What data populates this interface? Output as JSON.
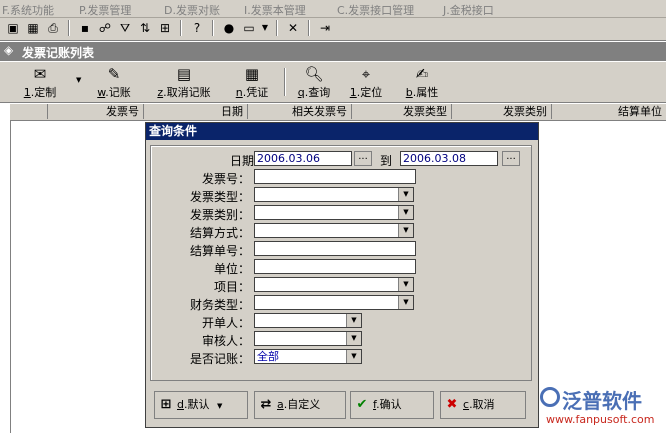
{
  "menu": [
    "F.系统功能",
    "P.发票管理",
    "D.发票对账",
    "I.发票本管理",
    "C.发票接口管理",
    "J.金税接口"
  ],
  "toolbar_icons": [
    "window-icon",
    "calculator-icon",
    "print-icon",
    "save-icon",
    "binoculars-icon",
    "filter-icon",
    "sort-icon",
    "grid-icon",
    "help-icon",
    "globe-icon",
    "window-menu-icon",
    "close-icon",
    "exit-icon"
  ],
  "window": {
    "title": "发票记账列表"
  },
  "actions": [
    {
      "key": "1",
      "label": ".定制",
      "icon": "customize-icon"
    },
    {
      "key": "w",
      "label": ".记账",
      "icon": "post-icon"
    },
    {
      "key": "z",
      "label": ".取消记账",
      "icon": "cancel-post-icon"
    },
    {
      "key": "n",
      "label": ".凭证",
      "icon": "voucher-icon"
    },
    {
      "key": "q",
      "label": ".查询",
      "icon": "query-icon"
    },
    {
      "key": "1",
      "label": ".定位",
      "icon": "locate-icon"
    },
    {
      "key": "b",
      "label": ".属性",
      "icon": "properties-icon"
    }
  ],
  "grid": {
    "columns": [
      "发票号",
      "日期",
      "相关发票号",
      "发票类型",
      "发票类别",
      "结算单位"
    ]
  },
  "dialog": {
    "title": "查询条件",
    "date_label": "日期：",
    "date_from": "2006.03.06",
    "date_to_label": "到",
    "date_to": "2006.03.08",
    "dots": "...",
    "fields": {
      "invoice_no": "发票号：",
      "invoice_type": "发票类型：",
      "invoice_category": "发票类别：",
      "settle_method": "结算方式：",
      "settle_no": "结算单号：",
      "unit": "单位：",
      "project": "项目：",
      "finance_type": "财务类型：",
      "issuer": "开单人：",
      "reviewer": "审核人：",
      "is_posted": "是否记账："
    },
    "is_posted_value": "全部",
    "buttons": {
      "default": {
        "key": "d",
        "label": ".默认"
      },
      "custom": {
        "key": "a",
        "label": ".自定义"
      },
      "ok": {
        "key": "f",
        "label": ".确认"
      },
      "cancel": {
        "key": "c",
        "label": ".取消"
      }
    }
  },
  "watermark": {
    "name": "泛普软件",
    "url": "www.fanpusoft.com"
  }
}
